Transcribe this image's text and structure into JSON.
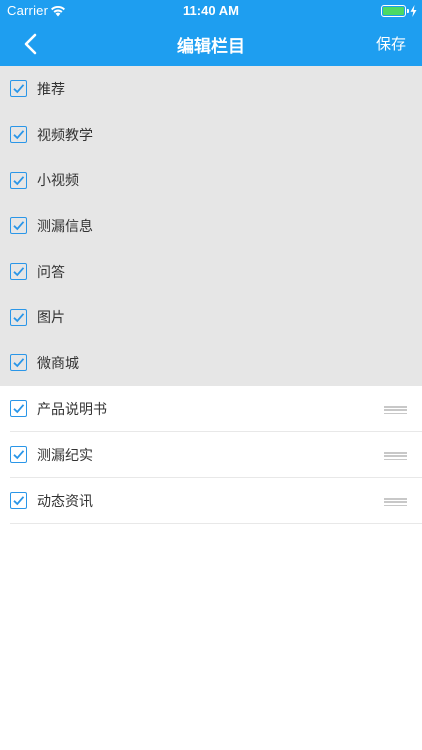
{
  "status_bar": {
    "carrier": "Carrier",
    "time": "11:40 AM",
    "battery_level": 1.0
  },
  "nav": {
    "title": "编辑栏目",
    "save_label": "保存"
  },
  "colors": {
    "header_bg": "#1e9ef0",
    "fixed_bg": "#e6e6e6",
    "checkbox": "#2a96e8"
  },
  "fixed_items": [
    {
      "label": "推荐",
      "checked": true
    },
    {
      "label": "视频教学",
      "checked": true
    },
    {
      "label": "小视频",
      "checked": true
    },
    {
      "label": "测漏信息",
      "checked": true
    },
    {
      "label": "问答",
      "checked": true
    },
    {
      "label": "图片",
      "checked": true
    },
    {
      "label": "微商城",
      "checked": true
    }
  ],
  "movable_items": [
    {
      "label": "产品说明书",
      "checked": true
    },
    {
      "label": "测漏纪实",
      "checked": true
    },
    {
      "label": "动态资讯",
      "checked": true
    }
  ]
}
